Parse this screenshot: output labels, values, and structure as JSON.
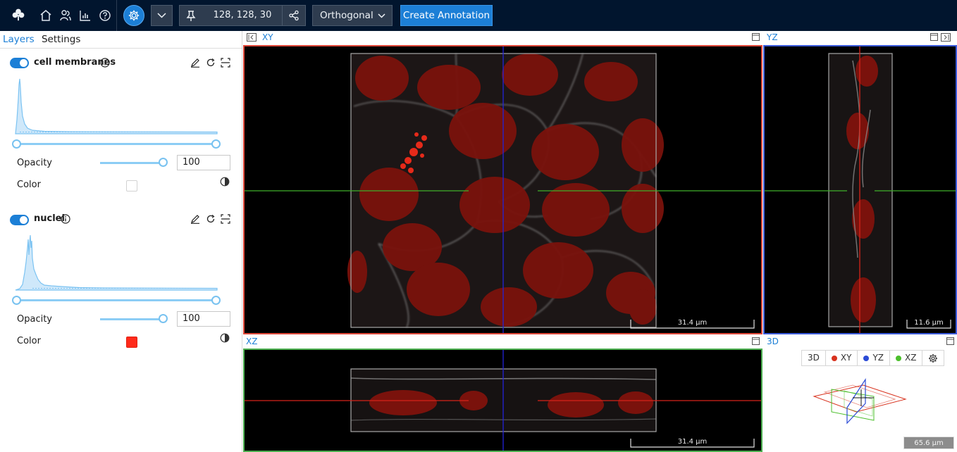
{
  "toolbar": {
    "icons": [
      "clover-logo-icon",
      "home-icon",
      "people-icon",
      "bar-chart-icon",
      "help-icon",
      "settings-icon",
      "chevron-down-icon",
      "pin-icon",
      "share-icon"
    ],
    "coordinates": "128, 128, 30",
    "view_mode": "Orthogonal",
    "create_annotation": "Create Annotation",
    "accent": "#1c7fd6",
    "background": "#01152e"
  },
  "left_panel": {
    "tabs": [
      {
        "label": "Layers",
        "active": true
      },
      {
        "label": "Settings",
        "active": false
      }
    ],
    "layers": [
      {
        "name": "cell membranes",
        "enabled": true,
        "opacity_label": "Opacity",
        "opacity": "100",
        "color_label": "Color",
        "color": "#ffffff"
      },
      {
        "name": "nuclei",
        "enabled": true,
        "opacity_label": "Opacity",
        "opacity": "100",
        "color_label": "Color",
        "color": "#ff2a1a"
      }
    ]
  },
  "viewports": {
    "xy": {
      "label": "XY",
      "scale": "31.4 µm",
      "border": "#e0483a"
    },
    "yz": {
      "label": "YZ",
      "scale": "11.6 µm",
      "border": "#3b5bdb"
    },
    "xz": {
      "label": "XZ",
      "scale": "31.4 µm",
      "border": "#4caf50"
    },
    "v3d": {
      "label": "3D",
      "buttons": [
        {
          "label": "3D"
        },
        {
          "label": "XY",
          "color": "#d8321e"
        },
        {
          "label": "YZ",
          "color": "#2b4bd6"
        },
        {
          "label": "XZ",
          "color": "#4cbf2c"
        }
      ],
      "scale": "65.6 µm"
    }
  }
}
